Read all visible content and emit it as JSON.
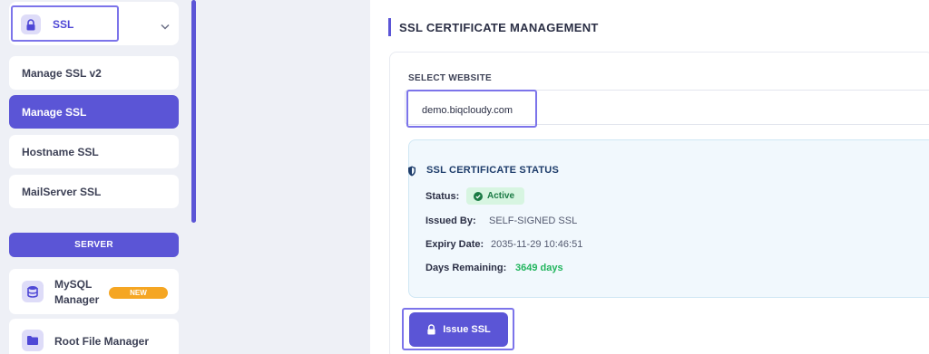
{
  "sidebar": {
    "ssl_group": {
      "label": "SSL",
      "icon": "lock-icon",
      "expand_icon": "chevron-down-icon"
    },
    "items": [
      {
        "label": "Manage SSL v2",
        "active": false
      },
      {
        "label": "Manage SSL",
        "active": true
      },
      {
        "label": "Hostname SSL",
        "active": false
      },
      {
        "label": "MailServer SSL",
        "active": false
      }
    ],
    "server_section": {
      "label": "SERVER"
    },
    "tools": [
      {
        "label": "MySQL Manager",
        "icon": "database-icon",
        "badge": "NEW"
      },
      {
        "label": "Root File Manager",
        "icon": "folder-icon"
      }
    ]
  },
  "main": {
    "title": "SSL CERTIFICATE MANAGEMENT",
    "select_label": "SELECT WEBSITE",
    "selected_website": "demo.biqcloudy.com",
    "status": {
      "title": "SSL CERTIFICATE STATUS",
      "icon": "shield-icon",
      "status_label": "Status:",
      "status_value": "Active",
      "issued_by_label": "Issued By:",
      "issued_by_value": "SELF-SIGNED SSL",
      "expiry_label": "Expiry Date:",
      "expiry_value": "2035-11-29 10:46:51",
      "days_label": "Days Remaining:",
      "days_value": "3649 days"
    },
    "issue_button": {
      "label": "Issue SSL",
      "icon": "lock-icon"
    }
  },
  "colors": {
    "accent": "#5b55d6",
    "highlight_outline": "#7c74ea",
    "success": "#22b55e",
    "badge_new": "#f5a623"
  }
}
